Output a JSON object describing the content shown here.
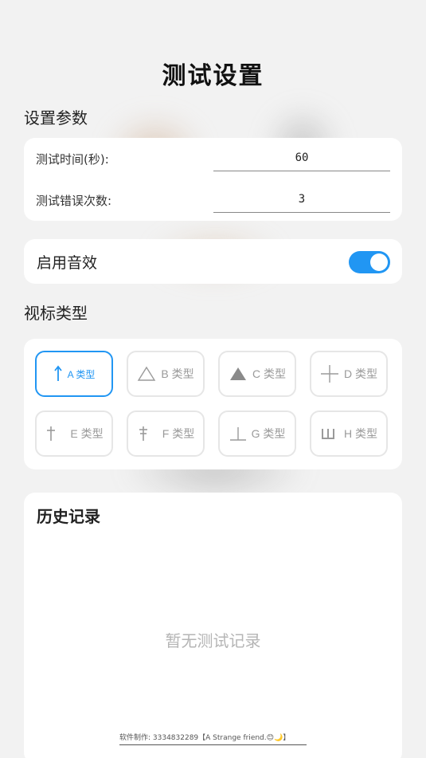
{
  "header": {
    "title": "测试设置"
  },
  "settings": {
    "section_label": "设置参数",
    "params": [
      {
        "label": "测试时间(秒):",
        "value": "60"
      },
      {
        "label": "测试错误次数:",
        "value": "3"
      }
    ]
  },
  "sound": {
    "label": "启用音效",
    "enabled": true,
    "accent_color": "#2196f3"
  },
  "types": {
    "section_label": "视标类型",
    "selected": "A 类型",
    "items": [
      {
        "label": "A 类型",
        "icon": "arrow-up-icon"
      },
      {
        "label": "B 类型",
        "icon": "triangle-outline-icon"
      },
      {
        "label": "C 类型",
        "icon": "triangle-filled-icon"
      },
      {
        "label": "D 类型",
        "icon": "cross-icon"
      },
      {
        "label": "E 类型",
        "icon": "dagger-icon"
      },
      {
        "label": "F 类型",
        "icon": "double-dagger-icon"
      },
      {
        "label": "G 类型",
        "icon": "up-tack-icon"
      },
      {
        "label": "H 类型",
        "icon": "trident-icon"
      }
    ]
  },
  "history": {
    "title": "历史记录",
    "empty_text": "暂无测试记录"
  },
  "footer": {
    "credit": "软件制作: 3334832289【A Strange friend.😊🌙】"
  }
}
